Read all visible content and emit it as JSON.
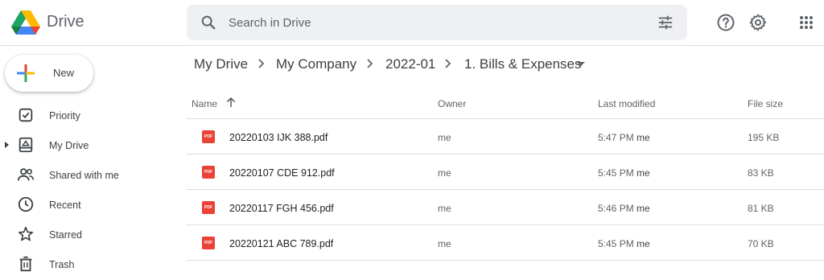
{
  "app": {
    "brand": "Drive"
  },
  "search": {
    "placeholder": "Search in Drive"
  },
  "sidebar": {
    "new_label": "New",
    "items": [
      {
        "label": "Priority",
        "icon": "checkbox-icon"
      },
      {
        "label": "My Drive",
        "icon": "my-drive-icon"
      },
      {
        "label": "Shared with me",
        "icon": "people-icon"
      },
      {
        "label": "Recent",
        "icon": "clock-icon"
      },
      {
        "label": "Starred",
        "icon": "star-icon"
      },
      {
        "label": "Trash",
        "icon": "trash-icon"
      }
    ]
  },
  "breadcrumb": [
    "My Drive",
    "My Company",
    "2022-01",
    "1. Bills & Expenses"
  ],
  "table": {
    "columns": {
      "name": "Name",
      "owner": "Owner",
      "modified": "Last modified",
      "size": "File size"
    },
    "rows": [
      {
        "name": "20220103 IJK 388.pdf",
        "owner": "me",
        "time": "5:47 PM",
        "by": "me",
        "size": "195 KB"
      },
      {
        "name": "20220107 CDE 912.pdf",
        "owner": "me",
        "time": "5:45 PM",
        "by": "me",
        "size": "83 KB"
      },
      {
        "name": "20220117 FGH 456.pdf",
        "owner": "me",
        "time": "5:46 PM",
        "by": "me",
        "size": "81 KB"
      },
      {
        "name": "20220121 ABC 789.pdf",
        "owner": "me",
        "time": "5:45 PM",
        "by": "me",
        "size": "70 KB"
      }
    ],
    "file_badge": "PDF"
  },
  "colors": {
    "pdf_red": "#ea4335",
    "search_bg": "#eef0f4",
    "divider": "#dadce0"
  }
}
